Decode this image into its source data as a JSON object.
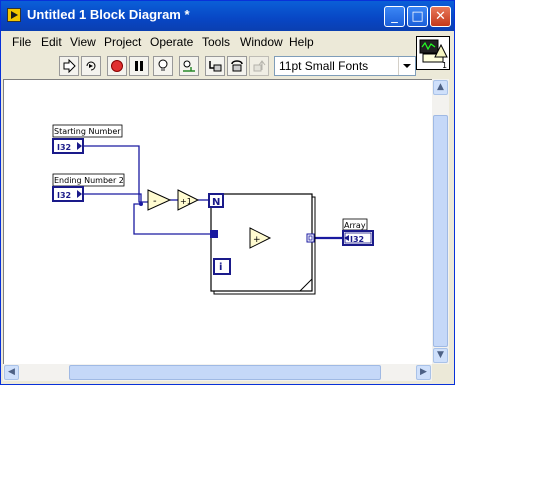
{
  "window": {
    "title": "Untitled 1 Block Diagram *"
  },
  "titlebar_buttons": {
    "minimize": "_",
    "maximize": "□",
    "close": "✕"
  },
  "menu": [
    "File",
    "Edit",
    "View",
    "Project",
    "Operate",
    "Tools",
    "Window",
    "Help"
  ],
  "toolbar": {
    "font_select": "11pt Small Fonts",
    "tools": [
      "run-arrow-icon",
      "run-continuously-icon",
      "abort-icon",
      "pause-icon",
      "highlight-execution-icon",
      "retain-wire-values-icon",
      "step-into-icon",
      "step-over-icon",
      "step-out-icon"
    ]
  },
  "vi_icon": {
    "number": "1"
  },
  "diagram": {
    "starting_label": "Starting Number",
    "ending_label": "Ending Number 2",
    "array_label": "Array",
    "type_i32": "I32",
    "loop_count": "N",
    "iteration": "i",
    "subtract": "-",
    "increment": "+1",
    "add": "+"
  },
  "colors": {
    "wire": "#1a1aa0",
    "node": "#fffbd0",
    "terminal": "#1a1a8a",
    "titlebar": "#0a5fd8"
  }
}
